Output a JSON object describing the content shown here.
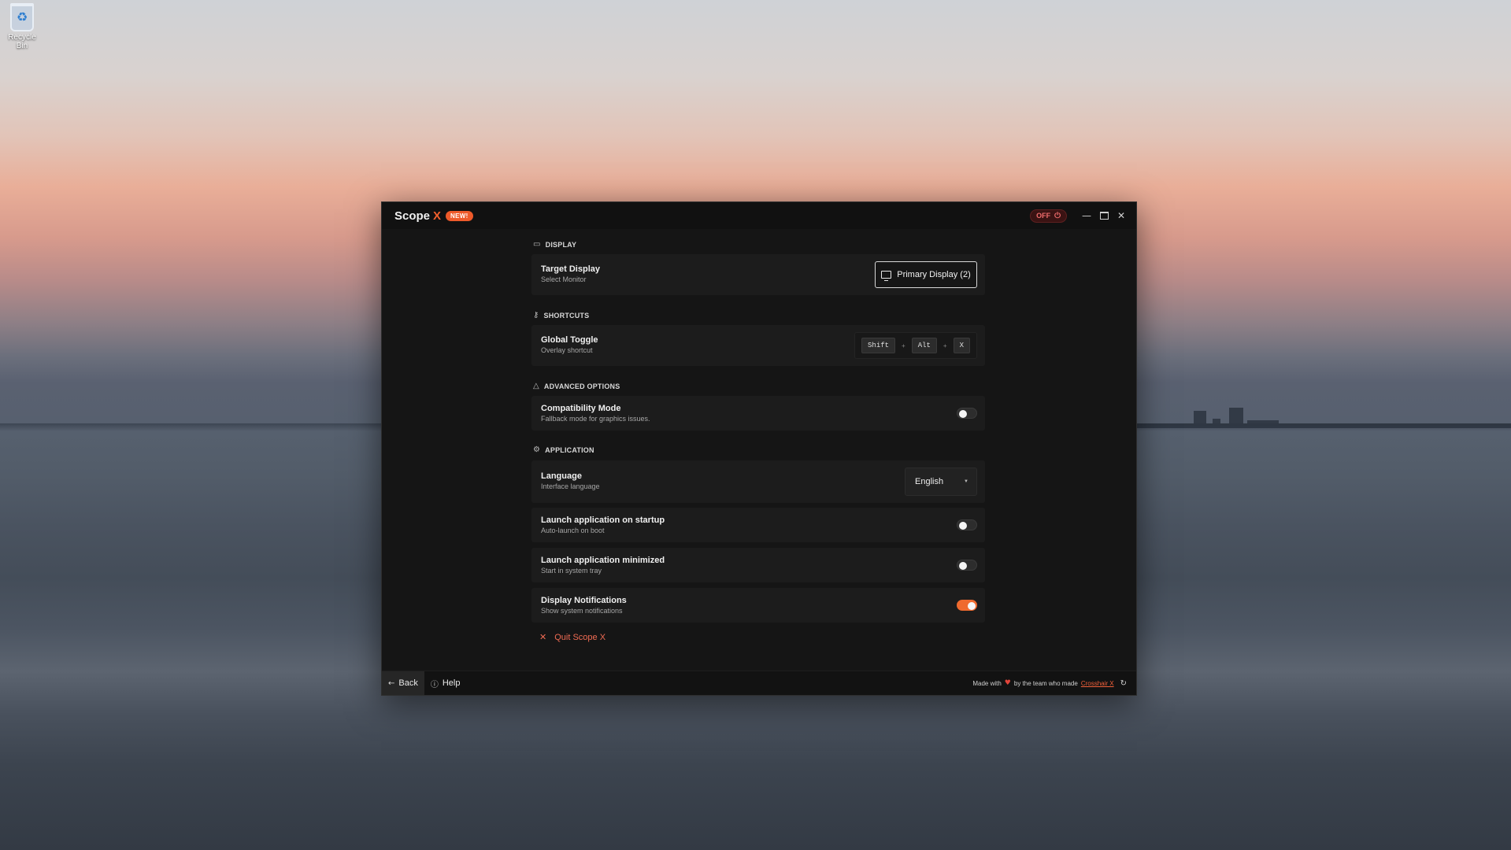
{
  "desktop": {
    "recycle_bin_label": "Recycle Bin"
  },
  "window": {
    "title": "Scope",
    "title_accent": "X",
    "badge": "NEW!",
    "status_label": "OFF",
    "accent_color": "#ef6a2e"
  },
  "sections": {
    "display": {
      "heading": "DISPLAY",
      "icon": "monitor-icon",
      "target_display": {
        "title": "Target Display",
        "subtitle": "Select Monitor",
        "button_label": "Primary Display (2)"
      }
    },
    "shortcuts": {
      "heading": "SHORTCUTS",
      "icon": "key-icon",
      "global_toggle": {
        "title": "Global Toggle",
        "subtitle": "Overlay shortcut",
        "keys": [
          "Shift",
          "Alt",
          "X"
        ],
        "separator": "+"
      }
    },
    "advanced": {
      "heading": "ADVANCED OPTIONS",
      "icon": "warning-icon",
      "compatibility_mode": {
        "title": "Compatibility Mode",
        "subtitle": "Fallback mode for graphics issues.",
        "enabled": false
      }
    },
    "application": {
      "heading": "APPLICATION",
      "icon": "gear-icon",
      "language": {
        "title": "Language",
        "subtitle": "Interface language",
        "selected": "English"
      },
      "launch_startup": {
        "title": "Launch application on startup",
        "subtitle": "Auto-launch on boot",
        "enabled": false
      },
      "launch_minimized": {
        "title": "Launch application minimized",
        "subtitle": "Start in system tray",
        "enabled": false
      },
      "notifications": {
        "title": "Display Notifications",
        "subtitle": "Show system notifications",
        "enabled": true
      }
    }
  },
  "quit_label": "Quit Scope X",
  "footer": {
    "back_label": "Back",
    "help_label": "Help",
    "credit_prefix": "Made with",
    "credit_middle": "by the team who made",
    "credit_link": "Crosshair X"
  }
}
